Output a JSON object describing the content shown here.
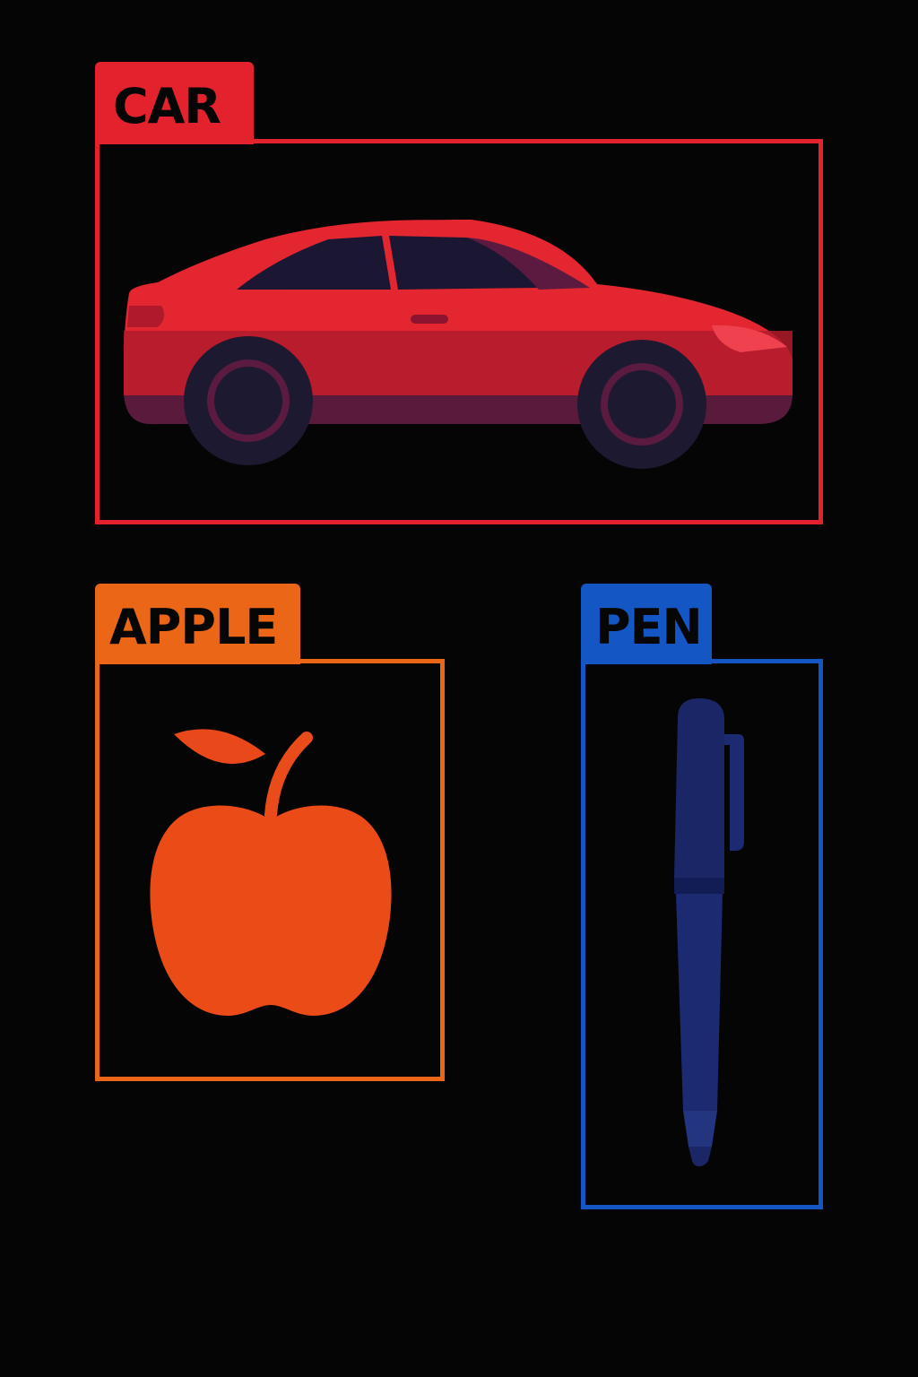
{
  "detections": [
    {
      "id": "car",
      "label": "CAR",
      "color": "#e3222e",
      "object": "car-illustration"
    },
    {
      "id": "apple",
      "label": "APPLE",
      "color": "#ec6617",
      "object": "apple-illustration"
    },
    {
      "id": "pen",
      "label": "PEN",
      "color": "#1456c4",
      "object": "pen-illustration"
    }
  ]
}
